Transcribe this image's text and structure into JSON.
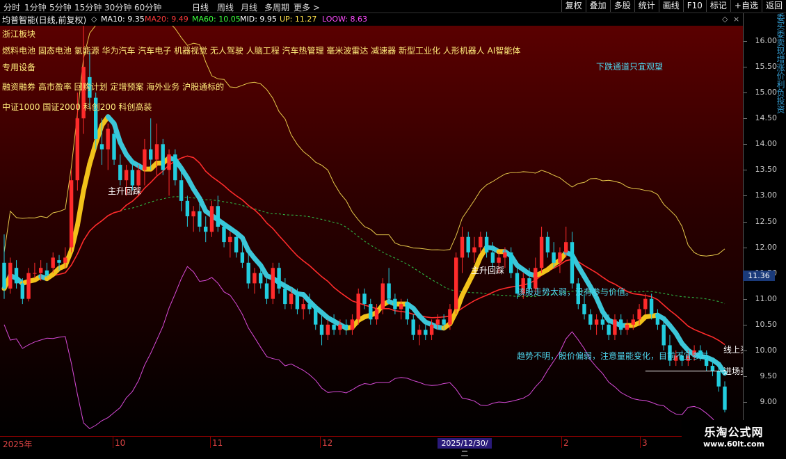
{
  "toolbar": {
    "periods": [
      "分时",
      "1分钟",
      "5分钟",
      "15分钟",
      "30分钟",
      "60分钟",
      "日线",
      "周线",
      "月线",
      "多周期",
      "更多 >"
    ],
    "active_period": "日线",
    "actions": [
      "复权",
      "叠加",
      "多股",
      "统计",
      "画线",
      "F10",
      "标记",
      "+自选",
      "返回"
    ]
  },
  "info": {
    "stock_title": "均普智能(日线,前复权)",
    "ma10": "MA10: 9.35",
    "ma20": "MA20: 9.49",
    "ma60": "MA60: 10.05",
    "mid": "MID: 9.95",
    "up": "UP: 11.27",
    "loow": "LOOW: 8.63",
    "colors": {
      "ma10": "#ffffff",
      "ma20": "#ff3b3b",
      "ma60": "#3cff3c",
      "mid": "#ffffff",
      "up": "#ffe14a",
      "loow": "#ff4cff"
    }
  },
  "sectors": {
    "line1": "浙江板块",
    "line2": "燃料电池 固态电池 氢能源 华为汽车 汽车电子 机器视觉 无人驾驶 人脑工程 汽车热管理 毫米波雷达 减速器 新型工业化 人形机器人 AI智能体",
    "line3": "专用设备",
    "line4": "融资融券 高市盈率 回购计划 定增预案 海外业务 沪股通标的",
    "line5": "中证1000 国证2000 科创200 科创高装"
  },
  "annotations": {
    "downtrend": "下跌通道只宜观望",
    "rise_pullback_1": "主升回踩",
    "rise_pullback_2": "主升回踩",
    "weak": "该股走势太弱，没有参与价值。",
    "unclear": "趋势不明，股价偏弱，注意量能变化，目前不宜参与",
    "line_up": "线上买",
    "entry": "进场买"
  },
  "price_axis": {
    "ticks": [
      "16.00",
      "15.50",
      "15.00",
      "14.50",
      "14.00",
      "13.50",
      "13.00",
      "12.50",
      "12.00",
      "11.50",
      "11.00",
      "10.50",
      "10.00",
      "9.50",
      "9.00"
    ],
    "current": "11.36"
  },
  "side_strip": "委买委卖现增涨价利负投资",
  "x_axis": {
    "labels": [
      "2025年",
      "10",
      "11",
      "12",
      "2",
      "3"
    ],
    "highlight_date": "2025/12/30/二"
  },
  "watermark": {
    "line1": "乐淘公式网",
    "line2": "www.60lt.com"
  },
  "chart_data": {
    "type": "candlestick",
    "y_range": [
      8.7,
      16.4
    ],
    "candles": [
      [
        11.7,
        12.25,
        11.0,
        11.2
      ],
      [
        11.2,
        11.8,
        11.1,
        11.7
      ],
      [
        11.6,
        11.75,
        11.2,
        11.3
      ],
      [
        11.3,
        11.4,
        10.9,
        11.0
      ],
      [
        11.0,
        11.6,
        10.95,
        11.5
      ],
      [
        11.5,
        11.7,
        11.4,
        11.5
      ],
      [
        11.5,
        11.75,
        11.35,
        11.6
      ],
      [
        11.55,
        11.7,
        11.4,
        11.45
      ],
      [
        11.6,
        11.9,
        11.5,
        11.8
      ],
      [
        11.75,
        11.85,
        11.55,
        11.7
      ],
      [
        11.7,
        12.0,
        11.6,
        11.8
      ],
      [
        12.0,
        13.5,
        11.9,
        13.3
      ],
      [
        13.3,
        15.0,
        13.1,
        14.5
      ],
      [
        14.5,
        16.3,
        14.2,
        15.5
      ],
      [
        15.3,
        15.8,
        14.7,
        14.9
      ],
      [
        14.9,
        15.0,
        13.9,
        14.1
      ],
      [
        14.0,
        14.5,
        13.6,
        13.9
      ],
      [
        13.9,
        14.4,
        13.5,
        14.3
      ],
      [
        14.2,
        14.3,
        13.6,
        13.7
      ],
      [
        13.6,
        13.8,
        13.2,
        13.3
      ],
      [
        13.3,
        13.6,
        13.0,
        13.5
      ],
      [
        13.5,
        13.7,
        13.1,
        13.2
      ],
      [
        13.2,
        13.6,
        13.0,
        13.5
      ],
      [
        13.5,
        14.1,
        13.2,
        13.9
      ],
      [
        13.9,
        14.5,
        13.5,
        13.7
      ],
      [
        13.7,
        14.4,
        13.4,
        14.0
      ],
      [
        14.0,
        14.1,
        13.4,
        13.5
      ],
      [
        13.5,
        13.9,
        13.0,
        13.8
      ],
      [
        13.8,
        13.9,
        13.2,
        13.3
      ],
      [
        13.3,
        13.5,
        12.7,
        12.9
      ],
      [
        12.9,
        13.0,
        12.4,
        12.6
      ],
      [
        12.6,
        12.8,
        12.3,
        12.7
      ],
      [
        12.7,
        12.9,
        12.3,
        12.4
      ],
      [
        12.4,
        12.6,
        12.1,
        12.3
      ],
      [
        12.3,
        12.9,
        12.2,
        12.8
      ],
      [
        12.8,
        13.0,
        12.3,
        12.4
      ],
      [
        12.4,
        12.5,
        12.0,
        12.1
      ],
      [
        12.1,
        12.3,
        11.8,
        12.2
      ],
      [
        12.2,
        12.3,
        11.8,
        11.9
      ],
      [
        11.9,
        12.1,
        11.6,
        11.7
      ],
      [
        11.7,
        11.9,
        11.2,
        11.3
      ],
      [
        11.3,
        11.6,
        11.1,
        11.5
      ],
      [
        11.5,
        11.7,
        11.2,
        11.3
      ],
      [
        11.3,
        11.4,
        10.9,
        11.0
      ],
      [
        11.0,
        11.7,
        10.9,
        11.6
      ],
      [
        11.6,
        11.7,
        11.1,
        11.2
      ],
      [
        11.2,
        11.4,
        10.8,
        10.9
      ],
      [
        10.9,
        11.2,
        10.8,
        11.1
      ],
      [
        11.1,
        11.2,
        10.7,
        10.8
      ],
      [
        10.8,
        11.0,
        10.6,
        10.9
      ],
      [
        10.9,
        11.1,
        10.7,
        10.8
      ],
      [
        10.8,
        10.9,
        10.4,
        10.5
      ],
      [
        10.5,
        10.7,
        10.1,
        10.3
      ],
      [
        10.3,
        10.6,
        10.2,
        10.5
      ],
      [
        10.5,
        10.7,
        10.3,
        10.4
      ],
      [
        10.4,
        10.6,
        10.3,
        10.5
      ],
      [
        10.5,
        10.6,
        10.3,
        10.4
      ],
      [
        10.4,
        10.7,
        10.3,
        10.6
      ],
      [
        10.6,
        11.2,
        10.5,
        11.1
      ],
      [
        11.1,
        11.2,
        10.8,
        10.9
      ],
      [
        10.9,
        11.0,
        10.5,
        10.6
      ],
      [
        10.6,
        10.9,
        10.5,
        10.8
      ],
      [
        10.8,
        11.4,
        10.7,
        11.3
      ],
      [
        11.3,
        11.6,
        10.9,
        11.0
      ],
      [
        11.0,
        11.1,
        10.7,
        10.8
      ],
      [
        10.8,
        11.0,
        10.6,
        10.9
      ],
      [
        10.9,
        11.0,
        10.5,
        10.6
      ],
      [
        10.6,
        10.7,
        10.2,
        10.3
      ],
      [
        10.3,
        10.5,
        10.1,
        10.4
      ],
      [
        10.4,
        10.5,
        10.2,
        10.3
      ],
      [
        10.3,
        10.6,
        10.2,
        10.5
      ],
      [
        10.5,
        10.7,
        10.4,
        10.6
      ],
      [
        10.6,
        10.7,
        10.4,
        10.5
      ],
      [
        10.5,
        10.9,
        10.4,
        10.8
      ],
      [
        10.8,
        11.9,
        10.7,
        11.8
      ],
      [
        11.8,
        12.4,
        11.5,
        12.2
      ],
      [
        12.2,
        12.3,
        11.8,
        11.9
      ],
      [
        11.9,
        12.2,
        11.7,
        12.0
      ],
      [
        12.0,
        12.3,
        11.9,
        12.2
      ],
      [
        12.2,
        12.3,
        11.8,
        11.9
      ],
      [
        11.9,
        12.1,
        11.6,
        11.7
      ],
      [
        11.7,
        11.9,
        11.5,
        11.8
      ],
      [
        11.8,
        12.0,
        11.6,
        11.9
      ],
      [
        11.9,
        12.0,
        11.4,
        11.5
      ],
      [
        11.5,
        11.6,
        11.0,
        11.1
      ],
      [
        11.1,
        11.5,
        11.0,
        11.4
      ],
      [
        11.4,
        11.6,
        11.1,
        11.2
      ],
      [
        11.2,
        11.8,
        11.1,
        11.6
      ],
      [
        11.6,
        12.4,
        11.5,
        12.2
      ],
      [
        12.2,
        12.3,
        11.8,
        11.9
      ],
      [
        11.9,
        12.1,
        11.6,
        11.7
      ],
      [
        11.7,
        12.0,
        11.5,
        11.9
      ],
      [
        11.9,
        12.4,
        11.8,
        12.1
      ],
      [
        12.1,
        12.3,
        11.2,
        11.3
      ],
      [
        11.3,
        11.4,
        10.8,
        10.9
      ],
      [
        10.9,
        11.1,
        10.6,
        10.7
      ],
      [
        10.7,
        10.8,
        10.4,
        10.5
      ],
      [
        10.5,
        10.7,
        10.3,
        10.6
      ],
      [
        10.6,
        10.8,
        10.4,
        10.5
      ],
      [
        10.5,
        10.7,
        10.2,
        10.3
      ],
      [
        10.3,
        10.7,
        10.2,
        10.6
      ],
      [
        10.6,
        10.7,
        10.3,
        10.4
      ],
      [
        10.4,
        10.6,
        10.3,
        10.5
      ],
      [
        10.5,
        10.7,
        10.4,
        10.6
      ],
      [
        10.6,
        10.9,
        10.5,
        10.8
      ],
      [
        10.8,
        11.1,
        10.7,
        11.0
      ],
      [
        11.0,
        11.1,
        10.6,
        10.7
      ],
      [
        10.7,
        10.8,
        10.4,
        10.5
      ],
      [
        10.5,
        10.6,
        10.0,
        10.1
      ],
      [
        10.1,
        10.3,
        9.7,
        9.8
      ],
      [
        9.8,
        10.0,
        9.7,
        9.9
      ],
      [
        9.9,
        10.0,
        9.7,
        9.8
      ],
      [
        9.8,
        10.0,
        9.7,
        9.9
      ],
      [
        9.9,
        10.1,
        9.8,
        10.0
      ],
      [
        10.0,
        10.1,
        9.8,
        9.9
      ],
      [
        9.9,
        10.0,
        9.6,
        9.7
      ],
      [
        9.7,
        9.8,
        9.5,
        9.6
      ],
      [
        9.6,
        9.7,
        9.2,
        9.3
      ],
      [
        9.3,
        9.4,
        8.8,
        8.85
      ]
    ],
    "up_color": "#ff2b2b",
    "down_color": "#22cdde"
  }
}
